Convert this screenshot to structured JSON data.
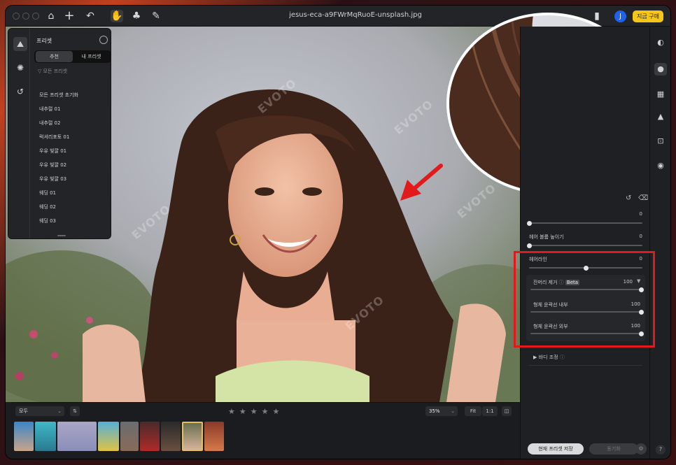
{
  "window": {
    "title": "jesus-eca-a9FWrMqRuoE-unsplash.jpg",
    "account_initial": "J",
    "buy_label": "지금 구매"
  },
  "toolbar": {
    "icons": [
      "home-icon",
      "plus-icon",
      "undo-icon",
      "hand-icon",
      "stamp-icon",
      "bandage-icon"
    ]
  },
  "canvas": {
    "watermark": "EVOTO"
  },
  "presets": {
    "title": "프리셋",
    "tabs": [
      "추천",
      "내 프리셋"
    ],
    "filter_label": "모든 프리셋",
    "items": [
      "모든 프리셋 초기화",
      "내추럴 01",
      "내추럴 02",
      "럭셔리포토 01",
      "우유 빛깔 01",
      "우유 빛깔 02",
      "우유 빛깔 03",
      "웨딩 01",
      "웨딩 02",
      "웨딩 03"
    ]
  },
  "adjust": {
    "sliders": [
      {
        "label": "헤어 볼륨 높이기",
        "value": "0",
        "level": 0
      },
      {
        "label": "헤어라인",
        "value": "0",
        "level": 0.5
      }
    ],
    "top_value": "0",
    "flyaway": {
      "label": "잔머리 제거",
      "badge": "Beta",
      "value": "100",
      "level": 1
    },
    "sub_sliders": [
      {
        "label": "형체 윤곽선 내부",
        "value": "100",
        "level": 1
      },
      {
        "label": "형체 윤곽선 외부",
        "value": "100",
        "level": 1
      }
    ],
    "body_label": "바디 조정",
    "save_label": "현재 프리셋 저장",
    "sync_label": "동기화"
  },
  "filmstrip": {
    "filter": "모두",
    "zoom": "35%",
    "fit": "Fit",
    "one": "1:1",
    "rating_stars": 5
  },
  "colors": {
    "accent": "#e0191c",
    "buy": "#f5c518",
    "account": "#1f62e8"
  }
}
